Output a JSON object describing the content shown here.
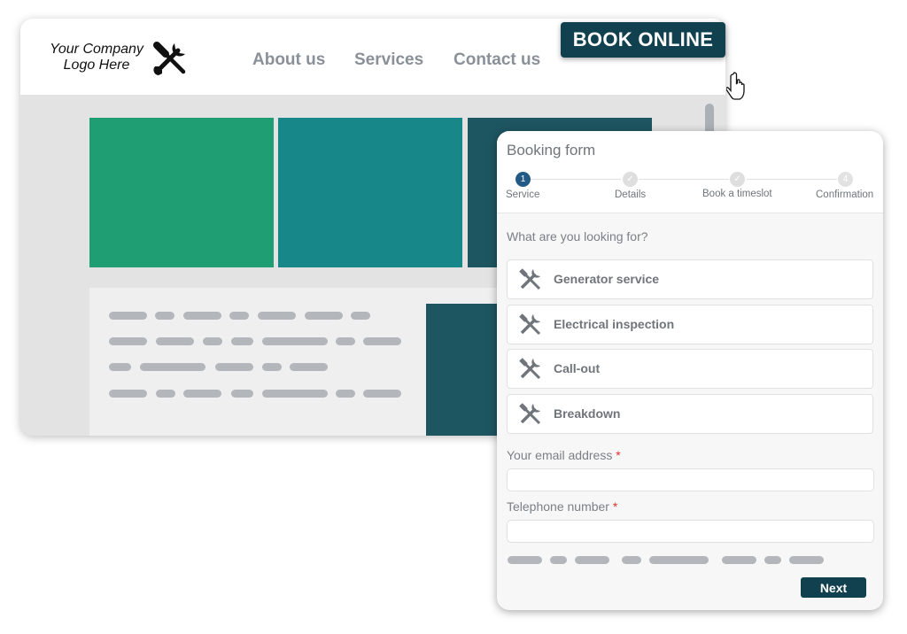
{
  "site": {
    "logo_text": "Your Company Logo Here",
    "nav": [
      "About us",
      "Services",
      "Contact us"
    ],
    "book_label": "BOOK ONLINE",
    "colors": {
      "green": "#1e9e72",
      "teal": "#188789",
      "dark_teal": "#1d5561",
      "button": "#11404f"
    }
  },
  "form": {
    "title": "Booking form",
    "steps": [
      {
        "label": "Service",
        "marker": "1",
        "state": "active"
      },
      {
        "label": "Details",
        "marker": "✓",
        "state": "done"
      },
      {
        "label": "Book a timeslot",
        "marker": "✓",
        "state": "done"
      },
      {
        "label": "Confirmation",
        "marker": "4",
        "state": "pending"
      }
    ],
    "question": "What are you looking for?",
    "options": [
      {
        "label": "Generator service",
        "icon": "tools-icon"
      },
      {
        "label": "Electrical inspection",
        "icon": "tools-icon"
      },
      {
        "label": "Call-out",
        "icon": "tools-icon"
      },
      {
        "label": "Breakdown",
        "icon": "tools-icon"
      }
    ],
    "email_label": "Your email address",
    "email_value": "",
    "phone_label": "Telephone number",
    "phone_value": "",
    "required_mark": "*",
    "next_label": "Next"
  }
}
